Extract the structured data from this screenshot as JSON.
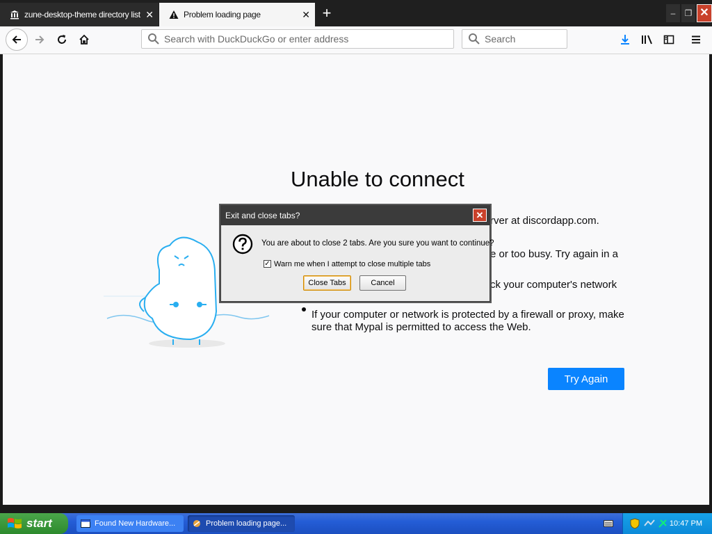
{
  "tabs": [
    {
      "label": "zune-desktop-theme directory listing",
      "icon": "archive-icon",
      "active": false
    },
    {
      "label": "Problem loading page",
      "icon": "warning-icon",
      "active": true
    }
  ],
  "toolbar": {
    "url_placeholder": "Search with DuckDuckGo or enter address",
    "search_placeholder": "Search"
  },
  "error_page": {
    "title": "Unable to connect",
    "partial_lines": [
      "rver at discordapp.com.",
      "e or too busy. Try again in a",
      "ck your computer's network"
    ],
    "bullet_line1": "If your computer or network is protected by a firewall or proxy, make",
    "bullet_line2": "sure that Mypal is permitted to access the Web.",
    "try_again_label": "Try Again"
  },
  "dialog": {
    "title": "Exit and close tabs?",
    "message": "You are about to close 2 tabs. Are you sure you want to continue?",
    "checkbox_label": "Warn me when I attempt to close multiple tabs",
    "checkbox_checked": true,
    "close_tabs_label": "Close Tabs",
    "cancel_label": "Cancel"
  },
  "taskbar": {
    "start_label": "start",
    "tasks": [
      {
        "label": "Found New Hardware..."
      },
      {
        "label": "Problem loading page..."
      }
    ],
    "clock": "10:47 PM"
  },
  "colors": {
    "accent": "#0a84ff",
    "close_red": "#c9412b",
    "taskbar_blue": "#245dd6"
  }
}
